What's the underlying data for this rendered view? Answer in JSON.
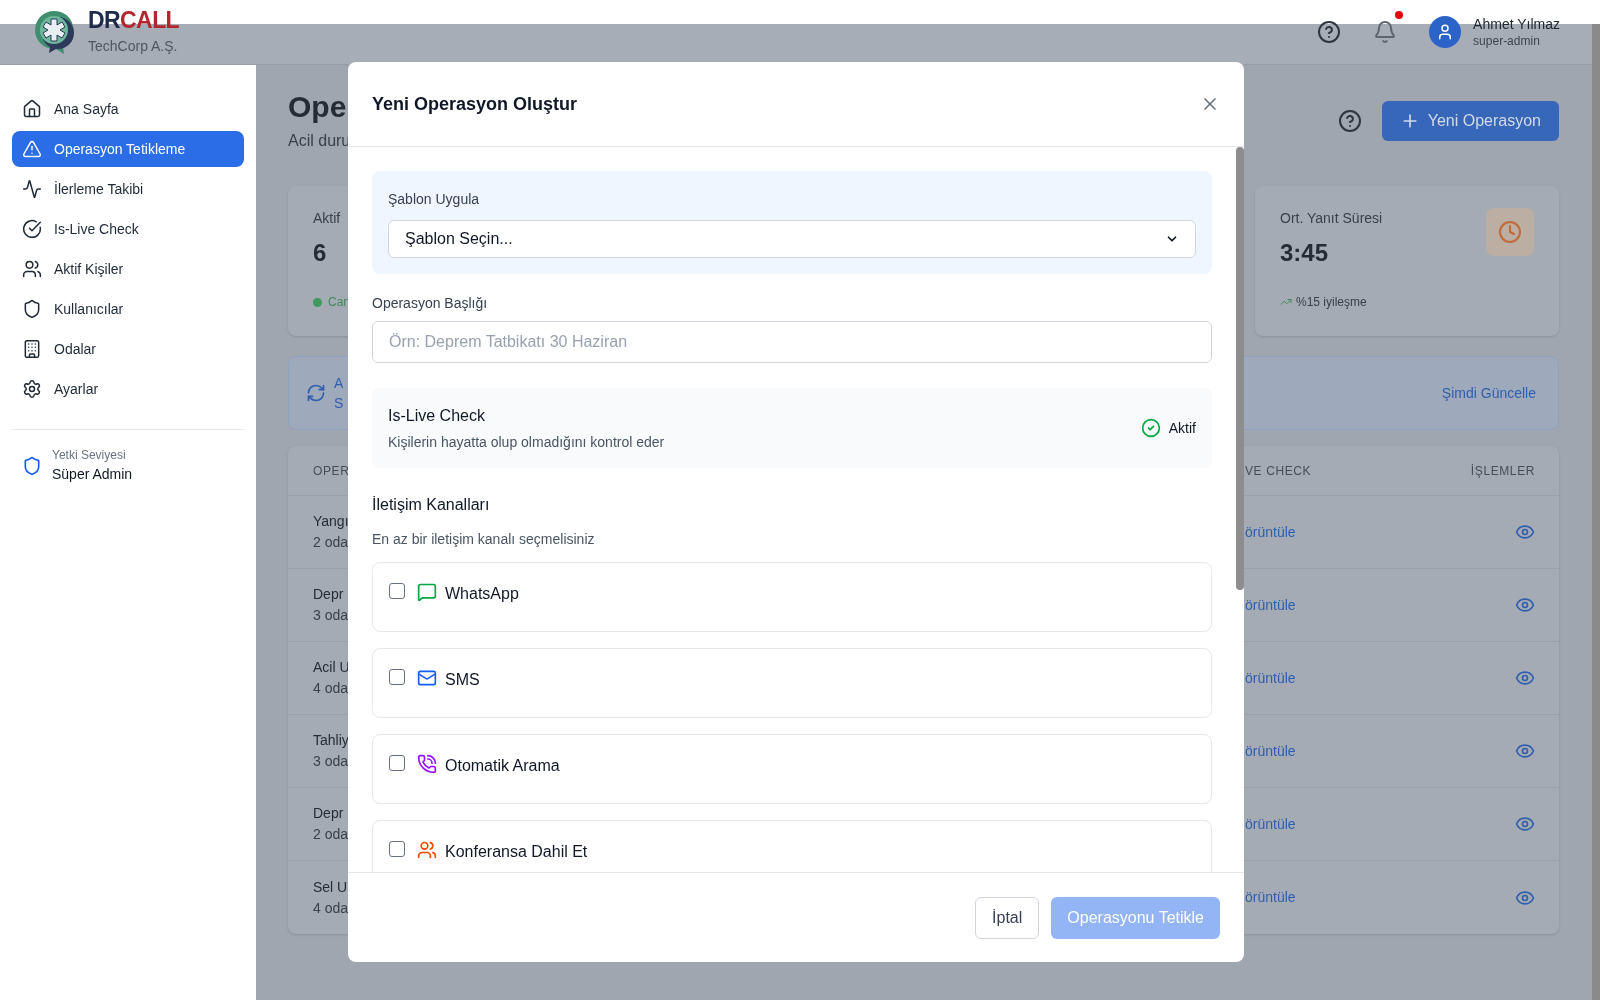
{
  "header": {
    "brand_first": "DR",
    "brand_second": "CALL",
    "organization": "TechCorp A.Ş.",
    "has_notification": true,
    "user": {
      "name": "Ahmet Yılmaz",
      "role": "super-admin"
    }
  },
  "sidebar": {
    "items": [
      {
        "label": "Ana Sayfa",
        "selected": false
      },
      {
        "label": "Operasyon Tetikleme",
        "selected": true
      },
      {
        "label": "İlerleme Takibi",
        "selected": false
      },
      {
        "label": "Is-Live Check",
        "selected": false
      },
      {
        "label": "Aktif Kişiler",
        "selected": false
      },
      {
        "label": "Kullanıcılar",
        "selected": false
      },
      {
        "label": "Odalar",
        "selected": false
      },
      {
        "label": "Ayarlar",
        "selected": false
      }
    ],
    "permission": {
      "label": "Yetki Seviyesi",
      "value": "Süper Admin"
    }
  },
  "page": {
    "title": "Ope",
    "subtitle": "Acil duru",
    "new_button": "Yeni Operasyon",
    "stat_left": {
      "label": "Aktif",
      "value": "6",
      "note": "Can"
    },
    "stat_right": {
      "label": "Ort. Yanıt Süresi",
      "value": "3:45",
      "trend": "%15 iyileşme"
    },
    "banner": {
      "line_1": "A",
      "line_2": "S",
      "action": "Şimdi Güncelle"
    },
    "table": {
      "columns": [
        "OPER",
        "VE CHECK",
        "İŞLEMLER"
      ],
      "rows": [
        {
          "title": "Yangı",
          "rooms": "2 oda",
          "link": "örüntüle"
        },
        {
          "title": "Depr",
          "rooms": "3 oda",
          "link": "örüntüle"
        },
        {
          "title": "Acil U",
          "rooms": "4 oda",
          "link": "örüntüle"
        },
        {
          "title": "Tahliy",
          "rooms": "3 oda",
          "link": "örüntüle"
        },
        {
          "title": "Depr",
          "rooms": "2 oda",
          "link": "örüntüle"
        },
        {
          "title": "Sel U",
          "rooms": "4 oda",
          "link": "örüntüle"
        }
      ]
    }
  },
  "modal": {
    "title": "Yeni Operasyon Oluştur",
    "template": {
      "label": "Şablon Uygula",
      "value": "Şablon Seçin..."
    },
    "title_field": {
      "label": "Operasyon Başlığı",
      "placeholder": "Örn: Deprem Tatbikatı 30 Haziran"
    },
    "live_check": {
      "title": "Is-Live Check",
      "description": "Kişilerin hayatta olup olmadığını kontrol eder",
      "status": "Aktif",
      "active": true
    },
    "channels": {
      "title": "İletişim Kanalları",
      "hint": "En az bir iletişim kanalı seçmelisiniz",
      "items": [
        {
          "kind": "whatsapp",
          "label": "WhatsApp",
          "checked": false
        },
        {
          "kind": "sms",
          "label": "SMS",
          "checked": false
        },
        {
          "kind": "call",
          "label": "Otomatik Arama",
          "checked": false
        },
        {
          "kind": "conference",
          "label": "Konferansa Dahil Et",
          "checked": false
        }
      ]
    },
    "cancel": "İptal",
    "submit": {
      "label": "Operasyonu Tetikle",
      "disabled": true
    }
  }
}
